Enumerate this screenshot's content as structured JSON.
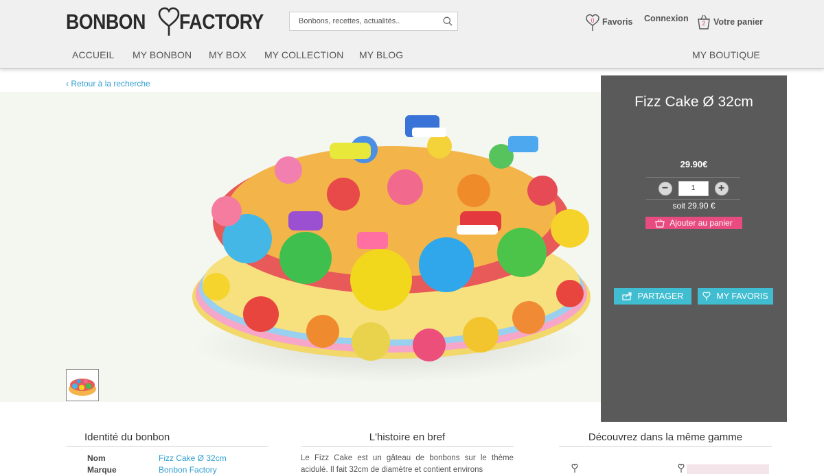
{
  "header": {
    "logo_left": "BONBON",
    "logo_right": "FACTORY",
    "search_placeholder": "Bonbons, recettes, actualités..",
    "favoris": {
      "label": "Favoris",
      "count": "0"
    },
    "connexion": "Connexion",
    "panier": {
      "label": "Votre panier",
      "count": "2"
    }
  },
  "nav": {
    "items": [
      "ACCUEIL",
      "MY BONBON",
      "MY BOX",
      "MY COLLECTION",
      "MY BLOG"
    ],
    "right": "MY BOUTIQUE"
  },
  "breadcrumb": {
    "back": "‹ Retour à la recherche"
  },
  "product": {
    "title": "Fizz Cake Ø 32cm",
    "price": "29.90€",
    "quantity": "1",
    "subtotal": "soit 29.90 €",
    "add_to_cart": "Ajouter au panier",
    "share": "PARTAGER",
    "favorite": "MY FAVORIS"
  },
  "sections": {
    "identity": {
      "title": "Identité du bonbon",
      "rows": [
        {
          "label": "Nom",
          "value": "Fizz Cake Ø 32cm"
        },
        {
          "label": "Marque",
          "value": "Bonbon Factory"
        }
      ]
    },
    "story": {
      "title": "L'histoire en bref",
      "text": "Le Fizz Cake est un gâteau de bonbons sur le thème acidulé. Il fait 32cm de diamètre et contient environs"
    },
    "range": {
      "title": "Découvrez dans la même gamme"
    }
  },
  "colors": {
    "accent_pink": "#e84b7f",
    "accent_cyan": "#40bdd0",
    "link_blue": "#2f9fd0",
    "panel_gray": "#5a5a5a"
  }
}
